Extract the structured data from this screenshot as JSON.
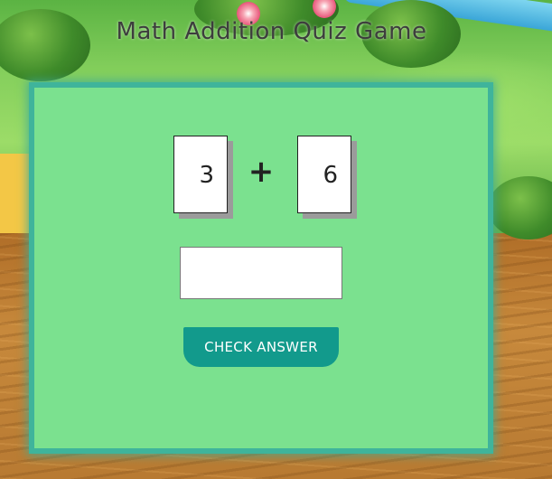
{
  "page": {
    "title": "Math Addition Quiz Game"
  },
  "quiz": {
    "left_operand": "3",
    "operator": "+",
    "right_operand": "6",
    "answer_value": "",
    "answer_placeholder": "",
    "check_label": "CHECK ANSWER"
  },
  "colors": {
    "panel_bg": "#7be18f",
    "panel_border": "#3fb49b",
    "button_bg": "#129a8c",
    "button_text": "#ffffff"
  }
}
